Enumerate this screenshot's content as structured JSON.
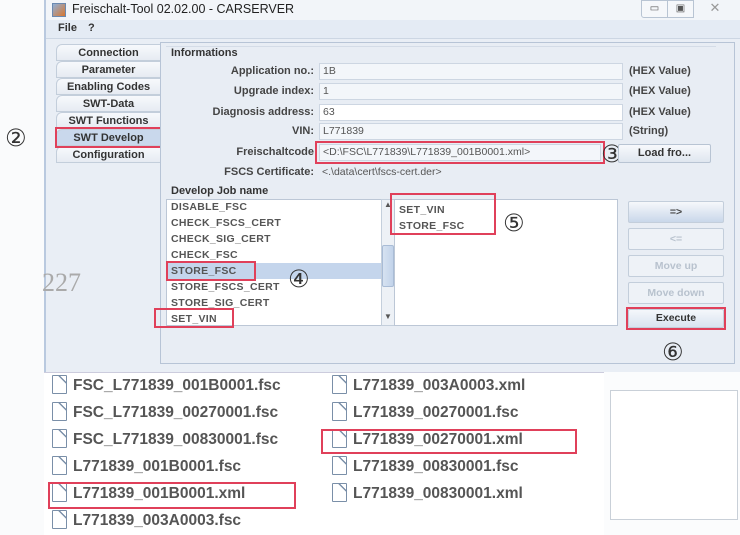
{
  "window": {
    "title": "Freischalt-Tool 02.02.00 - CARSERVER",
    "controls": {
      "minimize": "▭",
      "maximize": "▣",
      "close": "✕"
    }
  },
  "menu": [
    "File",
    "?"
  ],
  "tabs": [
    {
      "label": "Connection",
      "active": false
    },
    {
      "label": "Parameter",
      "active": false
    },
    {
      "label": "Enabling Codes",
      "active": false
    },
    {
      "label": "SWT-Data",
      "active": false
    },
    {
      "label": "SWT Functions",
      "active": false
    },
    {
      "label": "SWT Develop",
      "active": true
    },
    {
      "label": "Configuration",
      "active": false
    }
  ],
  "informations": {
    "title": "Informations",
    "fields": [
      {
        "label": "Application no.:",
        "value": "1B",
        "unit": "(HEX Value)"
      },
      {
        "label": "Upgrade index:",
        "value": "1",
        "unit": "(HEX Value)"
      },
      {
        "label": "Diagnosis address:",
        "value": "63",
        "unit": "(HEX Value)"
      },
      {
        "label": "VIN:",
        "value": "L771839",
        "unit": "(String)"
      },
      {
        "label": "Freischaltcode",
        "value": "<D:\\FSC\\L771839\\L771839_001B0001.xml>"
      },
      {
        "label": "FSCS Certificate:",
        "value": "<.\\data\\cert\\fscs-cert.der>"
      }
    ],
    "load_button": "Load fro..."
  },
  "develop": {
    "title": "Develop Job name",
    "available_jobs": [
      "DISABLE_FSC",
      "CHECK_FSCS_CERT",
      "CHECK_SIG_CERT",
      "CHECK_FSC",
      "STORE_FSC",
      "STORE_FSCS_CERT",
      "STORE_SIG_CERT",
      "SET_VIN"
    ],
    "selected_job": "STORE_FSC",
    "chosen_jobs": [
      "SET_VIN",
      "STORE_FSC"
    ],
    "buttons": {
      "add": "=>",
      "remove": "<=",
      "move_up": "Move up",
      "move_down": "Move down",
      "execute": "Execute"
    }
  },
  "annotations": {
    "step2": "②",
    "step3": "③",
    "step4": "④",
    "step5": "⑤",
    "step6": "⑥",
    "stray_text": "227"
  },
  "files": {
    "column1": [
      "FSC_L771839_001B0001.fsc",
      "FSC_L771839_00270001.fsc",
      "FSC_L771839_00830001.fsc",
      "L771839_001B0001.fsc",
      "L771839_001B0001.xml",
      "L771839_003A0003.fsc"
    ],
    "column2": [
      "L771839_003A0003.xml",
      "L771839_00270001.fsc",
      "L771839_00270001.xml",
      "L771839_00830001.fsc",
      "L771839_00830001.xml"
    ]
  }
}
